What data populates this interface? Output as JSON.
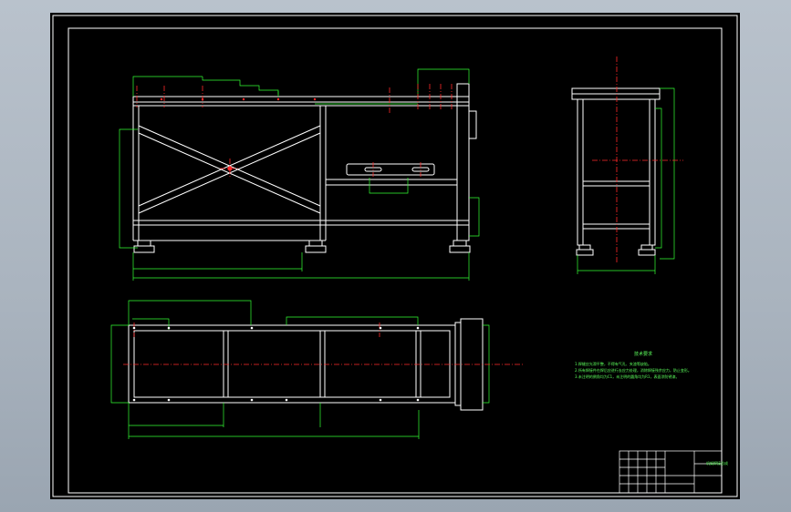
{
  "colors": {
    "background": "#000000",
    "outline": "#ffffff",
    "dimension": "#33ff33",
    "centerline": "#ff2a2a",
    "text": "#5cff5c"
  },
  "drawing": {
    "notes_title": "技术要求",
    "notes": [
      "1.焊缝应光滑平整，不得有气孔、夹渣等缺陷。",
      "2.所有焊接件在焊后应进行去应力处理，消除焊接残余应力，防止变形。",
      "3.未注明的倒角均为C1，未注明的圆角均为R1，表面涂防锈漆。"
    ],
    "title_block_name": "机架焊接总成"
  }
}
